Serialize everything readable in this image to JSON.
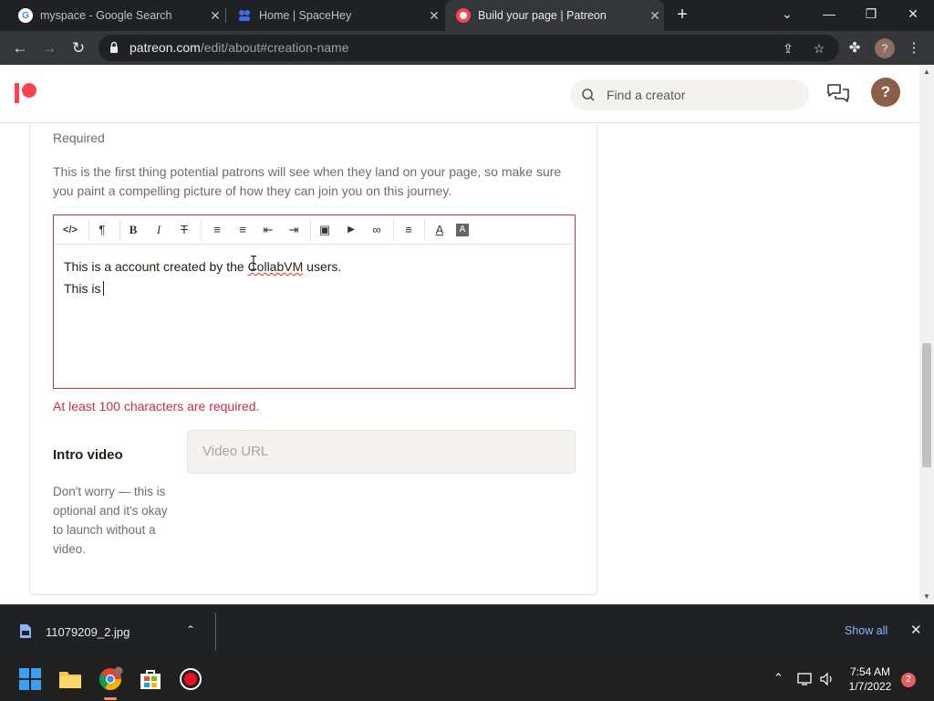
{
  "browser": {
    "tabs": [
      {
        "title": "myspace - Google Search",
        "favicon": "google-icon",
        "active": false
      },
      {
        "title": "Home | SpaceHey",
        "favicon": "spacehey-icon",
        "active": false
      },
      {
        "title": "Build your page | Patreon",
        "favicon": "patreon-icon",
        "active": true
      }
    ],
    "url_host": "patreon.com",
    "url_path": "/edit/about#creation-name"
  },
  "header": {
    "search_placeholder": "Find a creator",
    "help_label": "?"
  },
  "about": {
    "required_label": "Required",
    "help_text": "This is the first thing potential patrons will see when they land on your page, so make sure you paint a compelling picture of how they can join you on this journey.",
    "editor_line1_a": "This is a account created by the ",
    "editor_line1_b": "CollabVM",
    "editor_line1_c": " users.",
    "editor_line2": "This is",
    "error": "At least 100 characters are required."
  },
  "editor_toolbar": [
    {
      "name": "code-icon",
      "glyph": "</>"
    },
    {
      "name": "paragraph-icon",
      "glyph": "¶"
    },
    {
      "name": "bold-icon",
      "glyph": "B"
    },
    {
      "name": "italic-icon",
      "glyph": "I"
    },
    {
      "name": "strikethrough-icon",
      "glyph": "T"
    },
    {
      "name": "bullet-list-icon",
      "glyph": "≡"
    },
    {
      "name": "numbered-list-icon",
      "glyph": "≡"
    },
    {
      "name": "outdent-icon",
      "glyph": "⇤"
    },
    {
      "name": "indent-icon",
      "glyph": "⇥"
    },
    {
      "name": "image-icon",
      "glyph": "▣"
    },
    {
      "name": "video-icon",
      "glyph": "▶"
    },
    {
      "name": "link-icon",
      "glyph": "∞"
    },
    {
      "name": "align-icon",
      "glyph": "≡"
    },
    {
      "name": "text-color-icon",
      "glyph": "A"
    },
    {
      "name": "highlight-icon",
      "glyph": "A"
    }
  ],
  "intro_video": {
    "label": "Intro video",
    "help": "Don't worry — this is optional and it's okay to launch without a video.",
    "placeholder": "Video URL"
  },
  "download_shelf": {
    "file_name": "11079209_2.jpg",
    "show_all": "Show all"
  },
  "taskbar": {
    "time": "7:54 AM",
    "date": "1/7/2022",
    "notification_count": "2"
  },
  "colors": {
    "patreon_red": "#ff424d",
    "error_red": "#c8313b",
    "link_blue": "#8ab4f8"
  }
}
